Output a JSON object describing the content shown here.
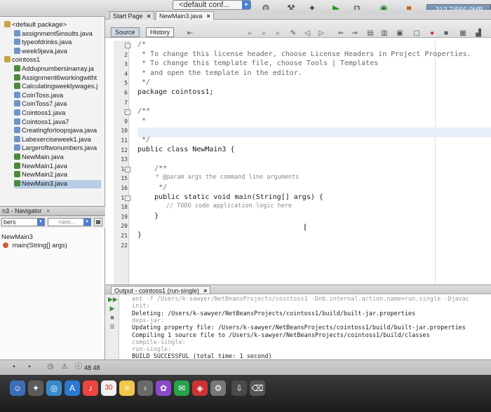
{
  "toolbar": {
    "config": "<default conf...",
    "memory": "313.7/656.0MB"
  },
  "projects": {
    "items": [
      {
        "label": "<default package>",
        "type": "pkg",
        "indent": 1
      },
      {
        "label": "assignment5insults.java",
        "type": "java",
        "indent": 2
      },
      {
        "label": "typeofdrinks.java",
        "type": "java",
        "indent": 2
      },
      {
        "label": "week9java.java",
        "type": "java",
        "indent": 2
      },
      {
        "label": "cointoss1",
        "type": "pkg",
        "indent": 1
      },
      {
        "label": "Addupnumbersinarray.ja",
        "type": "main",
        "indent": 2
      },
      {
        "label": "Assignment6workingwitht",
        "type": "main",
        "indent": 2
      },
      {
        "label": "Calculatingweeklywages.j",
        "type": "main",
        "indent": 2
      },
      {
        "label": "CoinToss.java",
        "type": "java",
        "indent": 2
      },
      {
        "label": "CoinToss7.java",
        "type": "java",
        "indent": 2
      },
      {
        "label": "Cointoss1.java",
        "type": "java",
        "indent": 2
      },
      {
        "label": "Cointoss1.java7",
        "type": "java",
        "indent": 2
      },
      {
        "label": "Creatingforloopsjava.java",
        "type": "java",
        "indent": 2
      },
      {
        "label": "Labexerciseweek1.java",
        "type": "java",
        "indent": 2
      },
      {
        "label": "Largeroftwonumbers.java",
        "type": "java",
        "indent": 2
      },
      {
        "label": "NewMain.java",
        "type": "main",
        "indent": 2
      },
      {
        "label": "NewMain1.java",
        "type": "main",
        "indent": 2
      },
      {
        "label": "NewMain2.java",
        "type": "main",
        "indent": 2
      },
      {
        "label": "NewMain3.java",
        "type": "main",
        "indent": 2
      }
    ]
  },
  "navigator": {
    "title": "n3 - Navigator",
    "filter_select": "bers",
    "filter_placeholder": "<em...",
    "items": [
      {
        "label": "NewMain3"
      },
      {
        "label": "main(String[] args)"
      }
    ]
  },
  "editor": {
    "tabs": [
      {
        "label": "Start Page"
      },
      {
        "label": "NewMain3.java"
      }
    ],
    "view_buttons": {
      "source": "Source",
      "history": "History"
    },
    "line_numbers": [
      "1",
      "2",
      "3",
      "4",
      "5",
      "6",
      "7",
      "8",
      "9",
      "10",
      "11",
      "12",
      "13",
      "14",
      "15",
      "16",
      "17",
      "18",
      "19",
      "20",
      "21",
      "22"
    ],
    "code": [
      "/*",
      " * To change this license header, choose License Headers in Project Properties.",
      " * To change this template file, choose Tools | Templates",
      " * and open the template in the editor.",
      " */",
      "package cointoss1;",
      "",
      "/**",
      " *",
      "",
      " */",
      "public class NewMain3 {",
      "",
      "    /**",
      "     * @param args the command line arguments",
      "     */",
      "    public static void main(String[] args) {",
      "        // TODO code application logic here",
      "    }",
      "",
      "}",
      ""
    ]
  },
  "output": {
    "tab": "Output - cointoss1 (run-single)",
    "lines": [
      "ant -f /Users/k-sawyer/NetBeansProjects/cointoss1 -Dnb.internal.action.name=run.single -Djavac",
      "init:",
      "Deleting: /Users/k-sawyer/NetBeansProjects/cointoss1/build/built-jar.properties",
      "deps-jar:",
      "Updating property file: /Users/k-sawyer/NetBeansProjects/cointoss1/build/built-jar.properties",
      "Compiling 1 source file to /Users/k-sawyer/NetBeansProjects/cointoss1/build/classes",
      "compile-single:",
      "run-single:",
      "BUILD SUCCESSFUL (total time: 1 second)"
    ]
  },
  "status": {
    "position": "48 48"
  },
  "dock": {
    "calendar_day": "30"
  }
}
